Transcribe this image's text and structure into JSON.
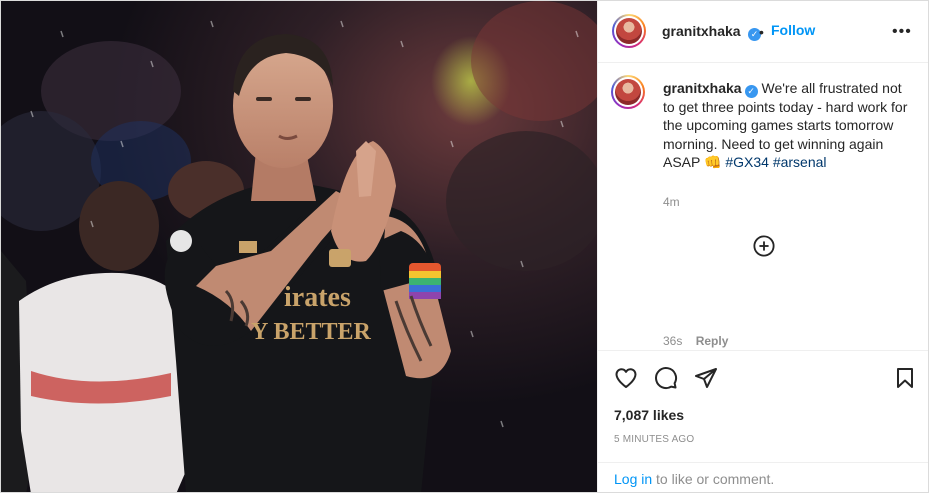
{
  "post": {
    "username": "granitxhaka",
    "verified_glyph": "✓",
    "dot": "•",
    "follow_label": "Follow",
    "more_label": "•••",
    "photo_description_icon": "player-photo",
    "photo_text": {
      "shirt_line1": "irates",
      "shirt_line2": "Y BETTER"
    }
  },
  "caption": {
    "username": "granitxhaka",
    "text": " We're all frustrated not to get three points today - hard work for the upcoming games starts tomorrow morning. Need to get winning again ASAP ",
    "emoji": "👊",
    "hashtags": [
      "#GX34",
      "#arsenal"
    ],
    "time": "4m"
  },
  "comments": {
    "load_more_icon": "plus-circle-icon",
    "partial_time": "36s",
    "partial_reply": "Reply"
  },
  "actions": {
    "icons": [
      "heart-icon",
      "comment-icon",
      "share-icon",
      "bookmark-icon"
    ],
    "likes": "7,087 likes",
    "posted_ago": "5 MINUTES AGO"
  },
  "login": {
    "link": "Log in",
    "rest": " to like or comment."
  },
  "colors": {
    "link_blue": "#0095f6",
    "hashtag": "#00376b",
    "muted": "#8e8e8e",
    "text": "#262626"
  }
}
